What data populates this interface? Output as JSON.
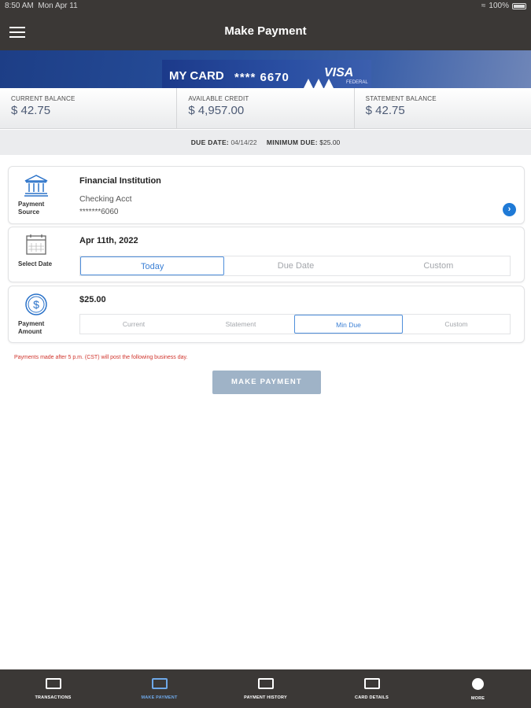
{
  "status": {
    "time": "8:50 AM",
    "date": "Mon Apr 11",
    "battery": "100%"
  },
  "header": {
    "title": "Make Payment",
    "menu_icon": "hamburger-icon"
  },
  "card": {
    "name": "MY CARD",
    "number": "**** 6670",
    "brand": "VISA",
    "issuer": "FEDERAL"
  },
  "balances": [
    {
      "label": "CURRENT BALANCE",
      "value": "$ 42.75"
    },
    {
      "label": "AVAILABLE CREDIT",
      "value": "$ 4,957.00"
    },
    {
      "label": "STATEMENT BALANCE",
      "value": "$ 42.75"
    }
  ],
  "due": {
    "date_label": "DUE DATE:",
    "date_value": "04/14/22",
    "min_label": "MINIMUM DUE:",
    "min_value": "$25.00"
  },
  "payment_source": {
    "label_line1": "Payment",
    "label_line2": "Source",
    "institution": "Financial Institution",
    "account": "Checking Acct",
    "account_number": "*******6060",
    "icon": "bank-icon"
  },
  "select_date": {
    "label": "Select Date",
    "date": "Apr 11th, 2022",
    "options": [
      "Today",
      "Due Date",
      "Custom"
    ],
    "selected": "Today",
    "icon": "calendar-icon"
  },
  "payment_amount": {
    "label_line1": "Payment",
    "label_line2": "Amount",
    "amount": "$25.00",
    "options": [
      "Current",
      "Statement",
      "Min Due",
      "Custom"
    ],
    "selected": "Min Due",
    "icon": "dollar-coin-icon"
  },
  "notice": "Payments made after 5 p.m. (CST) will post the following business day.",
  "submit_label": "MAKE PAYMENT",
  "nav": [
    {
      "label": "TRANSACTIONS",
      "icon": "transactions-icon",
      "active": false
    },
    {
      "label": "MAKE PAYMENT",
      "icon": "make-payment-icon",
      "active": true
    },
    {
      "label": "PAYMENT HISTORY",
      "icon": "payment-history-icon",
      "active": false
    },
    {
      "label": "CARD DETAILS",
      "icon": "card-details-icon",
      "active": false
    },
    {
      "label": "MORE",
      "icon": "more-icon",
      "active": false
    }
  ],
  "colors": {
    "header": "#3b3836",
    "accent": "#1f7ad6",
    "notice": "#d0342c",
    "button": "#9fb3c7"
  }
}
